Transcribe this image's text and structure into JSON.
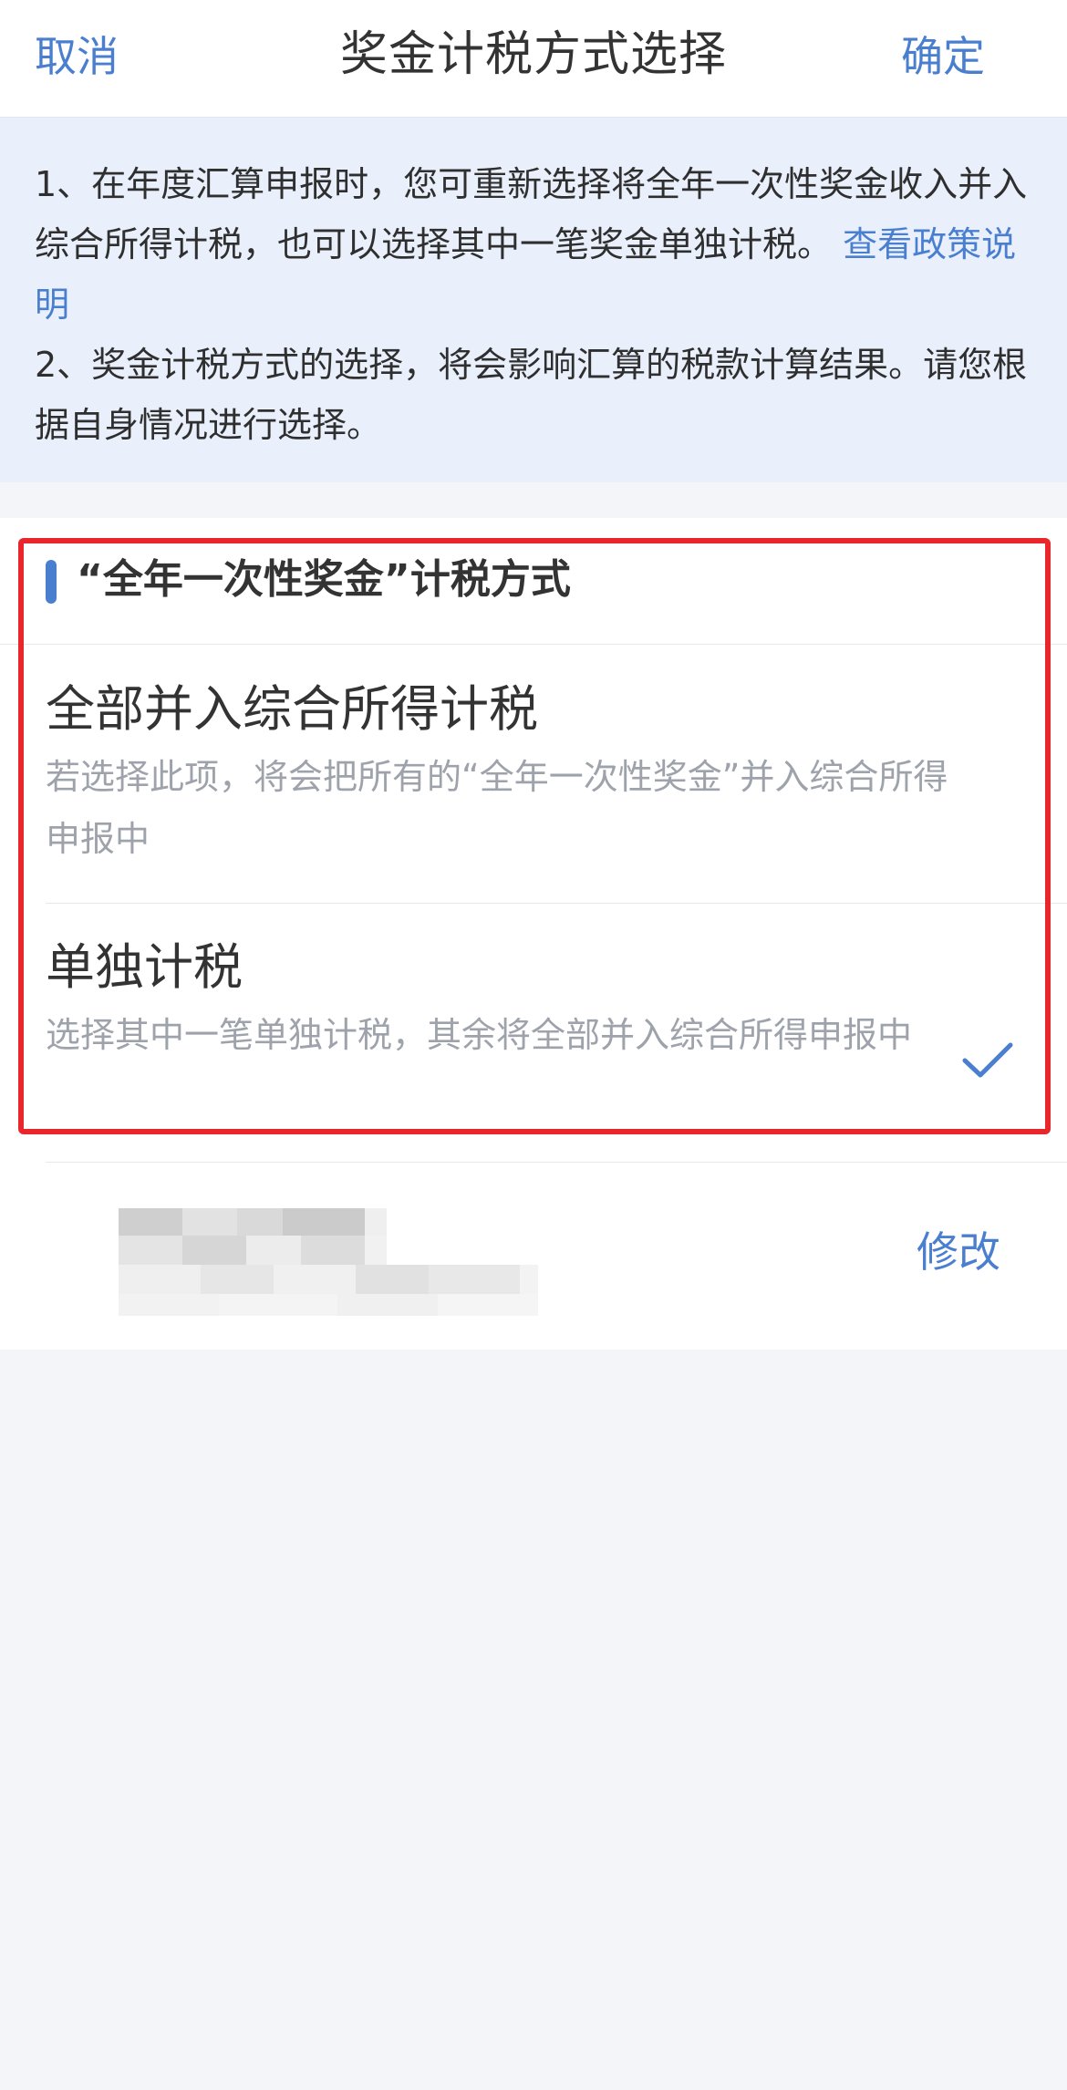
{
  "header": {
    "cancel_label": "取消",
    "title": "奖金计税方式选择",
    "confirm_label": "确定"
  },
  "notice": {
    "line1_text": "1、在年度汇算申报时，您可重新选择将全年一次性奖金收入并入综合所得计税，也可以选择其中一笔奖金单独计税。",
    "line1_link": "查看政策说明",
    "line2_text": "2、奖金计税方式的选择，将会影响汇算的税款计算结果。请您根据自身情况进行选择。"
  },
  "section": {
    "title": "“全年一次性奖金”计税方式"
  },
  "options": [
    {
      "title": "全部并入综合所得计税",
      "description": "若选择此项，将会把所有的“全年一次性奖金”并入综合所得申报中",
      "selected": false
    },
    {
      "title": "单独计税",
      "description": "选择其中一笔单独计税，其余将全部并入综合所得申报中",
      "selected": true
    }
  ],
  "bonus_row": {
    "edit_label": "修改"
  },
  "colors": {
    "accent": "#4a7fd0",
    "highlight_border": "#e8262b",
    "page_background": "#f3f5f9",
    "notice_background": "#e9f0fb"
  },
  "icons": {
    "selected_option": "checkmark-icon",
    "section_marker": "accent-bar"
  }
}
